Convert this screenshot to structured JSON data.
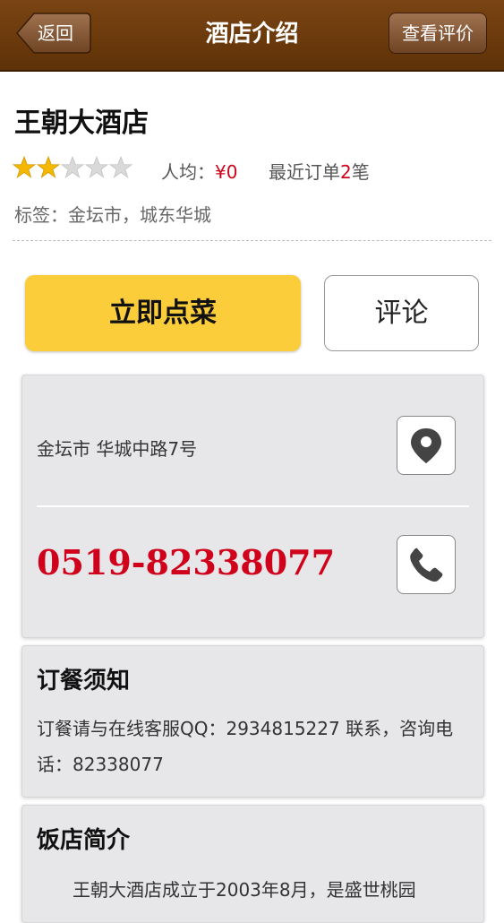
{
  "header": {
    "back_label": "返回",
    "title": "酒店介绍",
    "review_label": "查看评价"
  },
  "hotel": {
    "name": "王朝大酒店",
    "rating": 2,
    "rating_max": 5,
    "avg_label": "人均：",
    "avg_value": "¥0",
    "orders_prefix": "最近订单",
    "orders_count": "2",
    "orders_suffix": "笔",
    "tags": "标签：金坛市，城东华城"
  },
  "actions": {
    "order_label": "立即点菜",
    "comment_label": "评论"
  },
  "contact": {
    "address": "金坛市 华城中路7号",
    "phone": "0519-82338077"
  },
  "notice": {
    "title": "订餐须知",
    "text": "订餐请与在线客服QQ：2934815227 联系，咨询电话：82338077"
  },
  "intro": {
    "title": "饭店简介",
    "text": "王朝大酒店成立于2003年8月，是盛世桃园"
  },
  "colors": {
    "topbar": "#6a3a0e",
    "order_button": "#fccd3a",
    "accent_red": "#d0021b",
    "star_on": "#f5b800",
    "star_off": "#d9d9d9"
  }
}
